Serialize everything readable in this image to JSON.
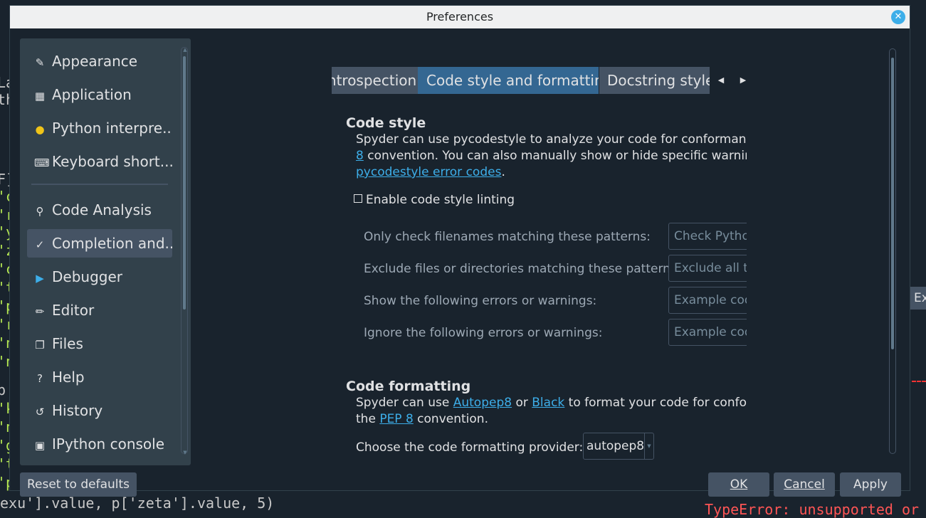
{
  "window": {
    "title": "Preferences"
  },
  "background": {
    "bottom_code": "exu'].value, p['zeta'].value, 5)",
    "error_text": "TypeError: unsupported or",
    "side_button": "Ex",
    "left_fragments": [
      "La",
      "th",
      "F]",
      "'c",
      "'r",
      "'y",
      "'z",
      "'c",
      "'t",
      "'p",
      "'r",
      "'n",
      "'n",
      "p",
      "'k",
      "'n",
      "'g",
      "'t",
      "'p"
    ]
  },
  "sidebar": {
    "items": [
      {
        "label": "Appearance",
        "icon": "eyedropper-icon"
      },
      {
        "label": "Application",
        "icon": "window-layout-icon"
      },
      {
        "label": "Python interpre...",
        "icon": "python-icon"
      },
      {
        "label": "Keyboard short...",
        "icon": "keyboard-icon"
      },
      {
        "label": "Code Analysis",
        "icon": "magnifier-check-icon"
      },
      {
        "label": "Completion and...",
        "icon": "completion-icon",
        "selected": true
      },
      {
        "label": "Debugger",
        "icon": "debugger-icon"
      },
      {
        "label": "Editor",
        "icon": "pencil-icon"
      },
      {
        "label": "Files",
        "icon": "files-icon"
      },
      {
        "label": "Help",
        "icon": "help-icon"
      },
      {
        "label": "History",
        "icon": "history-icon"
      },
      {
        "label": "IPython console",
        "icon": "console-icon"
      }
    ]
  },
  "tabs": {
    "items": [
      "Introspection",
      "Code style and formatting",
      "Docstring style"
    ],
    "active": "Code style and formatting"
  },
  "code_style": {
    "heading": "Code style",
    "desc_1": "Spyder can use pycodestyle to analyze your code for conformance to",
    "desc_link_1": "8",
    "desc_2": " convention. You can also manually show or hide specific warnings b",
    "desc_link_2": "pycodestyle error codes",
    "desc_end": ".",
    "enable_label": "Enable code style linting",
    "enable_checked": false,
    "fields": [
      {
        "label": "Only check filenames matching these patterns:",
        "placeholder": "Check Pythor"
      },
      {
        "label": "Exclude files or directories matching these patterns:",
        "placeholder": "Exclude all te"
      },
      {
        "label": "Show the following errors or warnings:",
        "placeholder": "Example code"
      },
      {
        "label": "Ignore the following errors or warnings:",
        "placeholder": "Example code"
      }
    ]
  },
  "code_formatting": {
    "heading": "Code formatting",
    "desc_1a": "Spyder can use ",
    "link_autopep8": "Autopep8",
    "desc_1b": " or ",
    "link_black": "Black",
    "desc_1c": " to format your code for conformar",
    "desc_2a": "the ",
    "link_pep8": "PEP 8",
    "desc_2b": " convention.",
    "provider_label": "Choose the code formatting provider:",
    "provider_value": "autopep8"
  },
  "buttons": {
    "reset": "Reset to defaults",
    "ok": "OK",
    "cancel": "Cancel",
    "apply": "Apply"
  },
  "colors": {
    "background": "#19232d",
    "panel": "#32414b",
    "selected": "#455364",
    "active_tab": "#346792",
    "link": "#3daee9",
    "text": "#e0e1e3"
  }
}
